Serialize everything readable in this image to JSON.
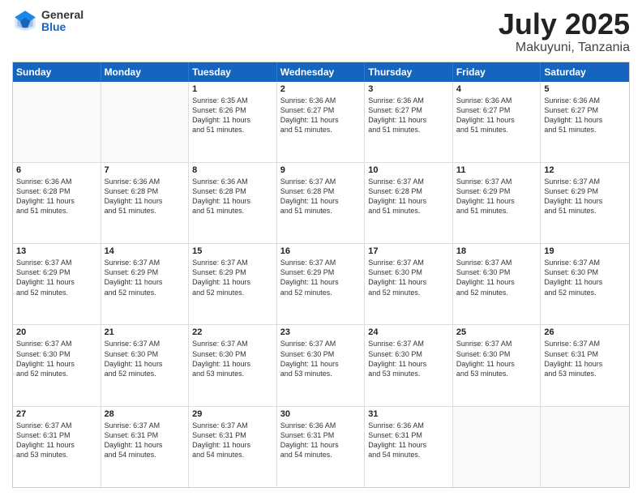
{
  "header": {
    "logo": {
      "general": "General",
      "blue": "Blue"
    },
    "month": "July 2025",
    "location": "Makuyuni, Tanzania"
  },
  "weekdays": [
    "Sunday",
    "Monday",
    "Tuesday",
    "Wednesday",
    "Thursday",
    "Friday",
    "Saturday"
  ],
  "weeks": [
    [
      {
        "day": "",
        "empty": true
      },
      {
        "day": "",
        "empty": true
      },
      {
        "day": "1",
        "lines": [
          "Sunrise: 6:35 AM",
          "Sunset: 6:26 PM",
          "Daylight: 11 hours",
          "and 51 minutes."
        ]
      },
      {
        "day": "2",
        "lines": [
          "Sunrise: 6:36 AM",
          "Sunset: 6:27 PM",
          "Daylight: 11 hours",
          "and 51 minutes."
        ]
      },
      {
        "day": "3",
        "lines": [
          "Sunrise: 6:36 AM",
          "Sunset: 6:27 PM",
          "Daylight: 11 hours",
          "and 51 minutes."
        ]
      },
      {
        "day": "4",
        "lines": [
          "Sunrise: 6:36 AM",
          "Sunset: 6:27 PM",
          "Daylight: 11 hours",
          "and 51 minutes."
        ]
      },
      {
        "day": "5",
        "lines": [
          "Sunrise: 6:36 AM",
          "Sunset: 6:27 PM",
          "Daylight: 11 hours",
          "and 51 minutes."
        ]
      }
    ],
    [
      {
        "day": "6",
        "lines": [
          "Sunrise: 6:36 AM",
          "Sunset: 6:28 PM",
          "Daylight: 11 hours",
          "and 51 minutes."
        ]
      },
      {
        "day": "7",
        "lines": [
          "Sunrise: 6:36 AM",
          "Sunset: 6:28 PM",
          "Daylight: 11 hours",
          "and 51 minutes."
        ]
      },
      {
        "day": "8",
        "lines": [
          "Sunrise: 6:36 AM",
          "Sunset: 6:28 PM",
          "Daylight: 11 hours",
          "and 51 minutes."
        ]
      },
      {
        "day": "9",
        "lines": [
          "Sunrise: 6:37 AM",
          "Sunset: 6:28 PM",
          "Daylight: 11 hours",
          "and 51 minutes."
        ]
      },
      {
        "day": "10",
        "lines": [
          "Sunrise: 6:37 AM",
          "Sunset: 6:28 PM",
          "Daylight: 11 hours",
          "and 51 minutes."
        ]
      },
      {
        "day": "11",
        "lines": [
          "Sunrise: 6:37 AM",
          "Sunset: 6:29 PM",
          "Daylight: 11 hours",
          "and 51 minutes."
        ]
      },
      {
        "day": "12",
        "lines": [
          "Sunrise: 6:37 AM",
          "Sunset: 6:29 PM",
          "Daylight: 11 hours",
          "and 51 minutes."
        ]
      }
    ],
    [
      {
        "day": "13",
        "lines": [
          "Sunrise: 6:37 AM",
          "Sunset: 6:29 PM",
          "Daylight: 11 hours",
          "and 52 minutes."
        ]
      },
      {
        "day": "14",
        "lines": [
          "Sunrise: 6:37 AM",
          "Sunset: 6:29 PM",
          "Daylight: 11 hours",
          "and 52 minutes."
        ]
      },
      {
        "day": "15",
        "lines": [
          "Sunrise: 6:37 AM",
          "Sunset: 6:29 PM",
          "Daylight: 11 hours",
          "and 52 minutes."
        ]
      },
      {
        "day": "16",
        "lines": [
          "Sunrise: 6:37 AM",
          "Sunset: 6:29 PM",
          "Daylight: 11 hours",
          "and 52 minutes."
        ]
      },
      {
        "day": "17",
        "lines": [
          "Sunrise: 6:37 AM",
          "Sunset: 6:30 PM",
          "Daylight: 11 hours",
          "and 52 minutes."
        ]
      },
      {
        "day": "18",
        "lines": [
          "Sunrise: 6:37 AM",
          "Sunset: 6:30 PM",
          "Daylight: 11 hours",
          "and 52 minutes."
        ]
      },
      {
        "day": "19",
        "lines": [
          "Sunrise: 6:37 AM",
          "Sunset: 6:30 PM",
          "Daylight: 11 hours",
          "and 52 minutes."
        ]
      }
    ],
    [
      {
        "day": "20",
        "lines": [
          "Sunrise: 6:37 AM",
          "Sunset: 6:30 PM",
          "Daylight: 11 hours",
          "and 52 minutes."
        ]
      },
      {
        "day": "21",
        "lines": [
          "Sunrise: 6:37 AM",
          "Sunset: 6:30 PM",
          "Daylight: 11 hours",
          "and 52 minutes."
        ]
      },
      {
        "day": "22",
        "lines": [
          "Sunrise: 6:37 AM",
          "Sunset: 6:30 PM",
          "Daylight: 11 hours",
          "and 53 minutes."
        ]
      },
      {
        "day": "23",
        "lines": [
          "Sunrise: 6:37 AM",
          "Sunset: 6:30 PM",
          "Daylight: 11 hours",
          "and 53 minutes."
        ]
      },
      {
        "day": "24",
        "lines": [
          "Sunrise: 6:37 AM",
          "Sunset: 6:30 PM",
          "Daylight: 11 hours",
          "and 53 minutes."
        ]
      },
      {
        "day": "25",
        "lines": [
          "Sunrise: 6:37 AM",
          "Sunset: 6:30 PM",
          "Daylight: 11 hours",
          "and 53 minutes."
        ]
      },
      {
        "day": "26",
        "lines": [
          "Sunrise: 6:37 AM",
          "Sunset: 6:31 PM",
          "Daylight: 11 hours",
          "and 53 minutes."
        ]
      }
    ],
    [
      {
        "day": "27",
        "lines": [
          "Sunrise: 6:37 AM",
          "Sunset: 6:31 PM",
          "Daylight: 11 hours",
          "and 53 minutes."
        ]
      },
      {
        "day": "28",
        "lines": [
          "Sunrise: 6:37 AM",
          "Sunset: 6:31 PM",
          "Daylight: 11 hours",
          "and 54 minutes."
        ]
      },
      {
        "day": "29",
        "lines": [
          "Sunrise: 6:37 AM",
          "Sunset: 6:31 PM",
          "Daylight: 11 hours",
          "and 54 minutes."
        ]
      },
      {
        "day": "30",
        "lines": [
          "Sunrise: 6:36 AM",
          "Sunset: 6:31 PM",
          "Daylight: 11 hours",
          "and 54 minutes."
        ]
      },
      {
        "day": "31",
        "lines": [
          "Sunrise: 6:36 AM",
          "Sunset: 6:31 PM",
          "Daylight: 11 hours",
          "and 54 minutes."
        ]
      },
      {
        "day": "",
        "empty": true
      },
      {
        "day": "",
        "empty": true
      }
    ]
  ]
}
